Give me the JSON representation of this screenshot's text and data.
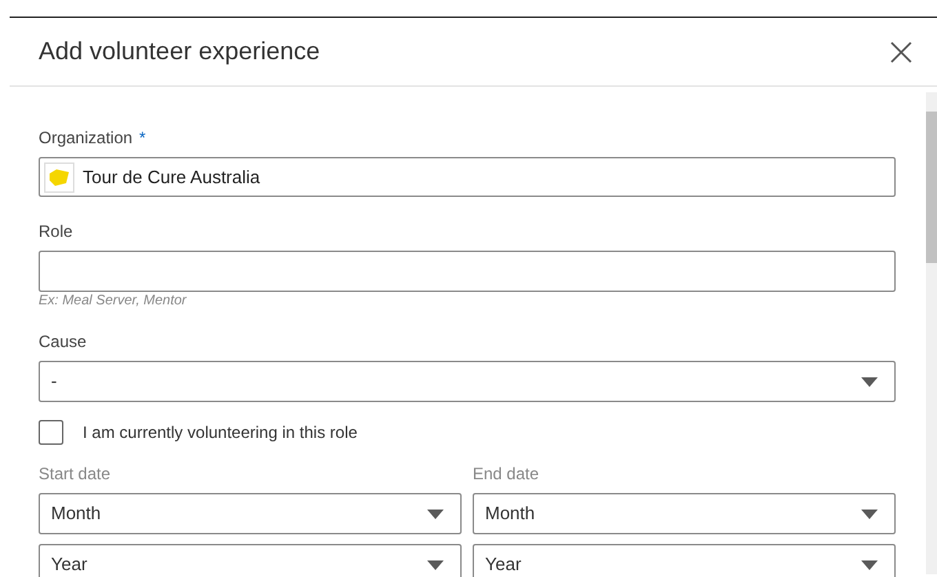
{
  "dialog": {
    "title": "Add volunteer experience"
  },
  "organization": {
    "label": "Organization",
    "required_mark": "*",
    "value": "Tour de Cure Australia"
  },
  "role": {
    "label": "Role",
    "hint": "Ex: Meal Server, Mentor"
  },
  "cause": {
    "label": "Cause",
    "value": "-"
  },
  "current": {
    "label": "I am currently volunteering in this role",
    "checked": false
  },
  "start_date": {
    "label": "Start date",
    "month": "Month",
    "year": "Year"
  },
  "end_date": {
    "label": "End date",
    "month": "Month",
    "year": "Year"
  }
}
